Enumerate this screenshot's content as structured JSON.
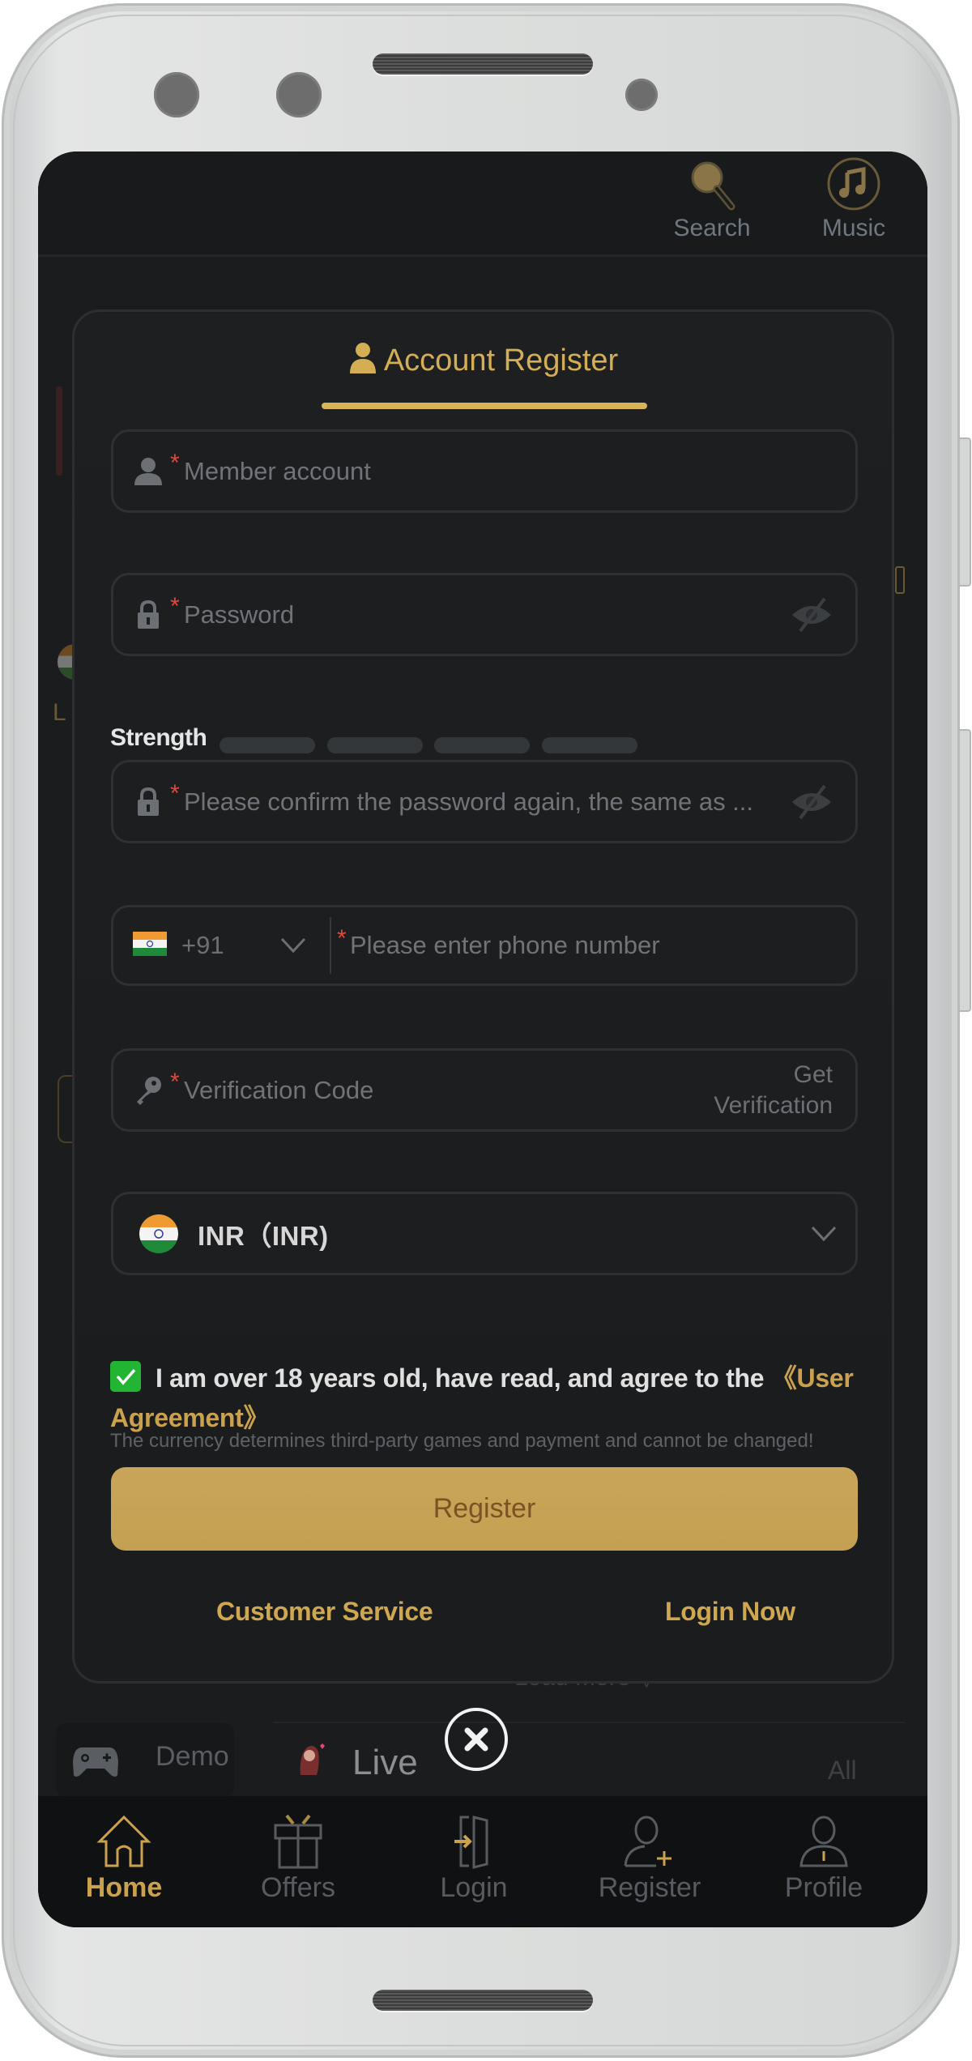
{
  "top_bar": {
    "actions": [
      {
        "label": "Search",
        "icon": "search-icon"
      },
      {
        "label": "Music",
        "icon": "music-icon"
      }
    ]
  },
  "modal": {
    "tab_title": "Account Register",
    "fields": {
      "member_account": {
        "placeholder": "Member account",
        "required_mark": "*"
      },
      "password": {
        "placeholder": "Password",
        "required_mark": "*"
      },
      "confirm_password": {
        "placeholder": "Please confirm the password again, the same as ...",
        "required_mark": "*"
      },
      "phone": {
        "country_code": "+91",
        "placeholder": "Please enter phone number",
        "required_mark": "*"
      },
      "verification": {
        "placeholder": "Verification Code",
        "required_mark": "*",
        "get_button_line1": "Get",
        "get_button_line2": "Verification"
      },
      "currency": {
        "selected": "INR（INR)"
      }
    },
    "strength": {
      "label": "Strength",
      "level": 0,
      "segments": 4
    },
    "currency_helper": "The currency determines third-party games and payment and cannot be changed!",
    "agreement": {
      "checked": true,
      "text": "I am over 18 years old, have read, and agree to the ",
      "link": "《User Agreement》"
    },
    "register_button": "Register",
    "customer_service": "Customer Service",
    "login_now": "Login Now"
  },
  "background": {
    "load_more": "Load More",
    "category_tabs": [
      {
        "label": "Demo",
        "icon": "gamepad-icon"
      },
      {
        "label": "Live",
        "icon": "live-dealer-icon"
      }
    ],
    "all_link": "All"
  },
  "bottom_nav": {
    "items": [
      {
        "label": "Home",
        "icon": "home-icon",
        "active": true
      },
      {
        "label": "Offers",
        "icon": "gift-icon",
        "active": false
      },
      {
        "label": "Login",
        "icon": "login-icon",
        "active": false
      },
      {
        "label": "Register",
        "icon": "add-user-icon",
        "active": false
      },
      {
        "label": "Profile",
        "icon": "profile-icon",
        "active": false
      }
    ]
  },
  "colors": {
    "accent_gold": "#d4ae55",
    "required_red": "#e0483c",
    "checkbox_green": "#22b533",
    "background": "#1a1c1e"
  }
}
